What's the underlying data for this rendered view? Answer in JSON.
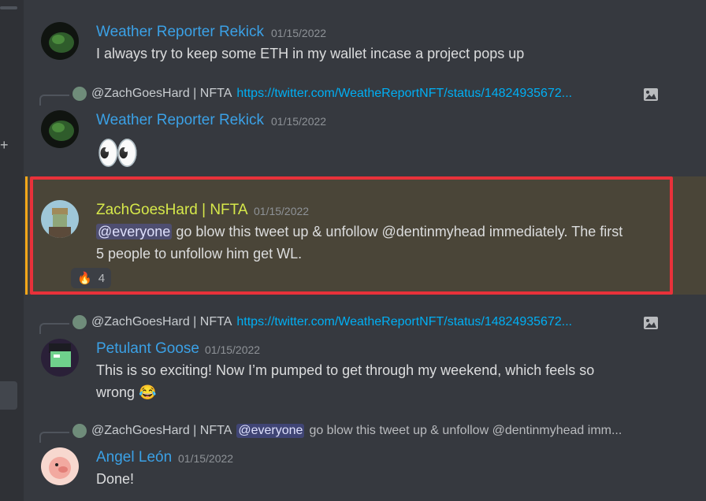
{
  "colors": {
    "background": "#36393f",
    "highlight": "#4a4538",
    "highlight_border": "#e8313a",
    "link": "#00aff4",
    "name_weather": "#3ba1e6",
    "name_zach": "#d6e84a",
    "name_goose": "#3ba1e6",
    "name_angel": "#3ba1e6"
  },
  "messages": [
    {
      "author": "Weather Reporter Rekick",
      "timestamp": "01/15/2022",
      "text": "I always try to keep some ETH in my wallet incase a project pops up",
      "avatar_icon": "green-blob-avatar-icon"
    },
    {
      "reply_to": {
        "author": "@ZachGoesHard | NFTA",
        "snippet": "https://twitter.com/WeatheReportNFT/status/14824935672...",
        "image_icon": "image-icon"
      },
      "author": "Weather Reporter Rekick",
      "timestamp": "01/15/2022",
      "emoji": "👀",
      "avatar_icon": "green-blob-avatar-icon"
    },
    {
      "author": "ZachGoesHard | NFTA",
      "timestamp": "01/15/2022",
      "mention": "@everyone",
      "text_line1": " go blow this tweet up & unfollow @dentinmyhead immediately. The first",
      "text_line2": "5 people to unfollow him get WL.",
      "reaction_emoji": "🔥",
      "reaction_count": "4",
      "avatar_icon": "zombie-avatar-icon"
    },
    {
      "reply_to": {
        "author": "@ZachGoesHard | NFTA",
        "snippet": "https://twitter.com/WeatheReportNFT/status/14824935672...",
        "image_icon": "image-icon"
      },
      "author": "Petulant Goose",
      "timestamp": "01/15/2022",
      "text_line1": "This is so exciting! Now I’m pumped to get through my weekend, which feels so",
      "text_line2": "wrong",
      "emoji": "😂",
      "avatar_icon": "goose-avatar-icon"
    },
    {
      "reply_to": {
        "author": "@ZachGoesHard | NFTA",
        "mention": "@everyone",
        "snippet": " go blow this tweet up & unfollow @dentinmyhead imm..."
      },
      "author": "Angel León",
      "timestamp": "01/15/2022",
      "text": "Done!",
      "avatar_icon": "pig-avatar-icon"
    }
  ]
}
